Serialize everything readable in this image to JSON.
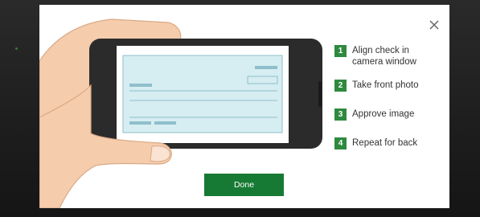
{
  "modal": {
    "steps": [
      {
        "number": "1",
        "label": "Align check in camera window"
      },
      {
        "number": "2",
        "label": "Take front photo"
      },
      {
        "number": "3",
        "label": "Approve image"
      },
      {
        "number": "4",
        "label": "Repeat for back"
      }
    ],
    "done_label": "Done",
    "close_icon": "close-icon",
    "illustration_icon": "hand-holding-phone-check-icon"
  },
  "colors": {
    "accent": "#2e8a3e",
    "button": "#177a34",
    "check_fill": "#d6edf2",
    "hand": "#f5ccac"
  }
}
